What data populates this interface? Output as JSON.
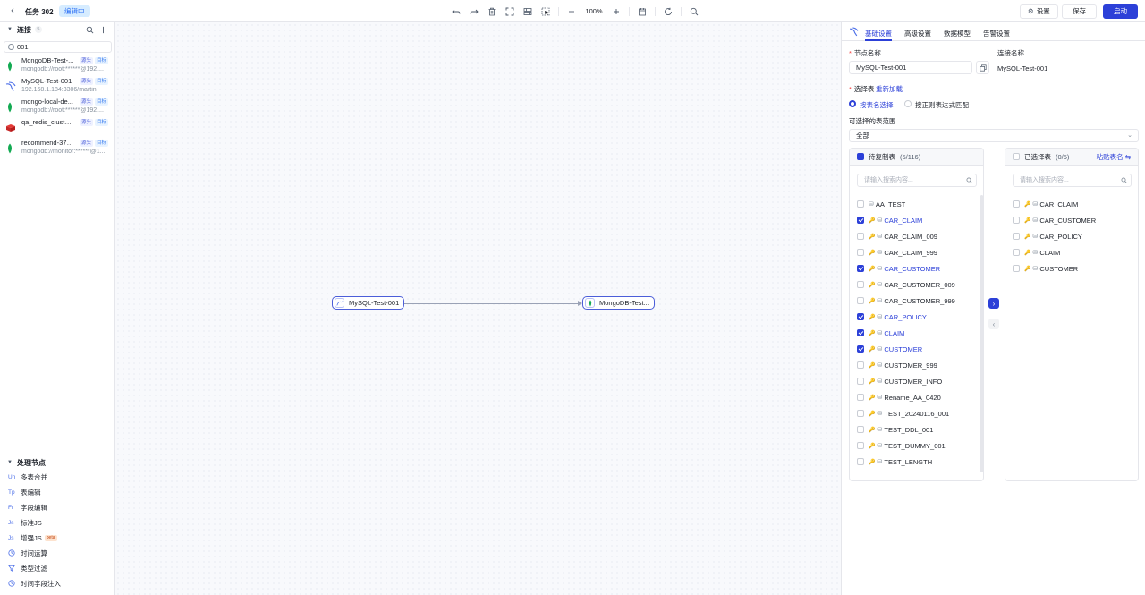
{
  "header": {
    "task_title": "任务 302",
    "status": "编辑中",
    "zoom": "100%",
    "settings_label": "设置",
    "save_label": "保存",
    "start_label": "启动"
  },
  "sidebar": {
    "connections_title": "连接",
    "connections_count": "5",
    "search_value": "001",
    "connections": [
      {
        "name": "MongoDB-Test-...",
        "sub": "mongodb://root:******@192....",
        "icon": "mongodb-icon",
        "tags": [
          "源头",
          "目标"
        ]
      },
      {
        "name": "MySQL-Test-001",
        "sub": "192.168.1.184:3306/martin",
        "icon": "mysql-icon",
        "tags": [
          "源头",
          "目标"
        ]
      },
      {
        "name": "mongo-local-de...",
        "sub": "mongodb://root:******@192....",
        "icon": "mongodb-icon",
        "tags": [
          "源头",
          "目标"
        ]
      },
      {
        "name": "qa_redis_cluster...",
        "sub": "",
        "icon": "redis-icon",
        "tags": [
          "源头",
          "目标"
        ]
      },
      {
        "name": "recommend-370...",
        "sub": "mongodb://monitor:******@1...",
        "icon": "mongodb-icon",
        "tags": [
          "源头",
          "目标"
        ]
      }
    ],
    "process_title": "处理节点",
    "processors": [
      {
        "code": "Un",
        "label": "多表合并"
      },
      {
        "code": "Tp",
        "label": "表编辑"
      },
      {
        "code": "Fr",
        "label": "字段编辑"
      },
      {
        "code": "Js",
        "label": "标准JS"
      },
      {
        "code": "Js",
        "label": "增强JS",
        "badge": "beta"
      },
      {
        "code": "clock",
        "label": "时间运算"
      },
      {
        "code": "filter",
        "label": "类型过滤"
      },
      {
        "code": "clock",
        "label": "时间字段注入"
      }
    ]
  },
  "canvas": {
    "source_node": "MySQL-Test-001",
    "target_node": "MongoDB-Test..."
  },
  "panel": {
    "tabs": [
      "基础设置",
      "高级设置",
      "数据模型",
      "告警设置"
    ],
    "node_name_label": "节点名称",
    "node_name_value": "MySQL-Test-001",
    "conn_name_label": "连接名称",
    "conn_name_value": "MySQL-Test-001",
    "select_table_label": "选择表",
    "reload_label": "重新加载",
    "radio_by_name": "按表名选择",
    "radio_by_regex": "按正则表达式匹配",
    "range_label": "可选择的表范围",
    "range_value": "全部",
    "pending_title": "待复制表",
    "pending_count": "(5/116)",
    "selected_title": "已选择表",
    "selected_count": "(0/5)",
    "paste_label": "粘贴表名",
    "search_placeholder": "请输入搜索内容...",
    "pending_tables": [
      {
        "name": "AA_TEST",
        "checked": false,
        "key": false
      },
      {
        "name": "CAR_CLAIM",
        "checked": true,
        "key": true
      },
      {
        "name": "CAR_CLAIM_009",
        "checked": false,
        "key": true
      },
      {
        "name": "CAR_CLAIM_999",
        "checked": false,
        "key": true
      },
      {
        "name": "CAR_CUSTOMER",
        "checked": true,
        "key": true
      },
      {
        "name": "CAR_CUSTOMER_009",
        "checked": false,
        "key": true
      },
      {
        "name": "CAR_CUSTOMER_999",
        "checked": false,
        "key": true
      },
      {
        "name": "CAR_POLICY",
        "checked": true,
        "key": true
      },
      {
        "name": "CLAIM",
        "checked": true,
        "key": true
      },
      {
        "name": "CUSTOMER",
        "checked": true,
        "key": true
      },
      {
        "name": "CUSTOMER_999",
        "checked": false,
        "key": true
      },
      {
        "name": "CUSTOMER_INFO",
        "checked": false,
        "key": true
      },
      {
        "name": "Rename_AA_0420",
        "checked": false,
        "key": true
      },
      {
        "name": "TEST_20240116_001",
        "checked": false,
        "key": true
      },
      {
        "name": "TEST_DDL_001",
        "checked": false,
        "key": true
      },
      {
        "name": "TEST_DUMMY_001",
        "checked": false,
        "key": true
      },
      {
        "name": "TEST_LENGTH",
        "checked": false,
        "key": true
      }
    ],
    "selected_tables": [
      "CAR_CLAIM",
      "CAR_CUSTOMER",
      "CAR_POLICY",
      "CLAIM",
      "CUSTOMER"
    ]
  }
}
